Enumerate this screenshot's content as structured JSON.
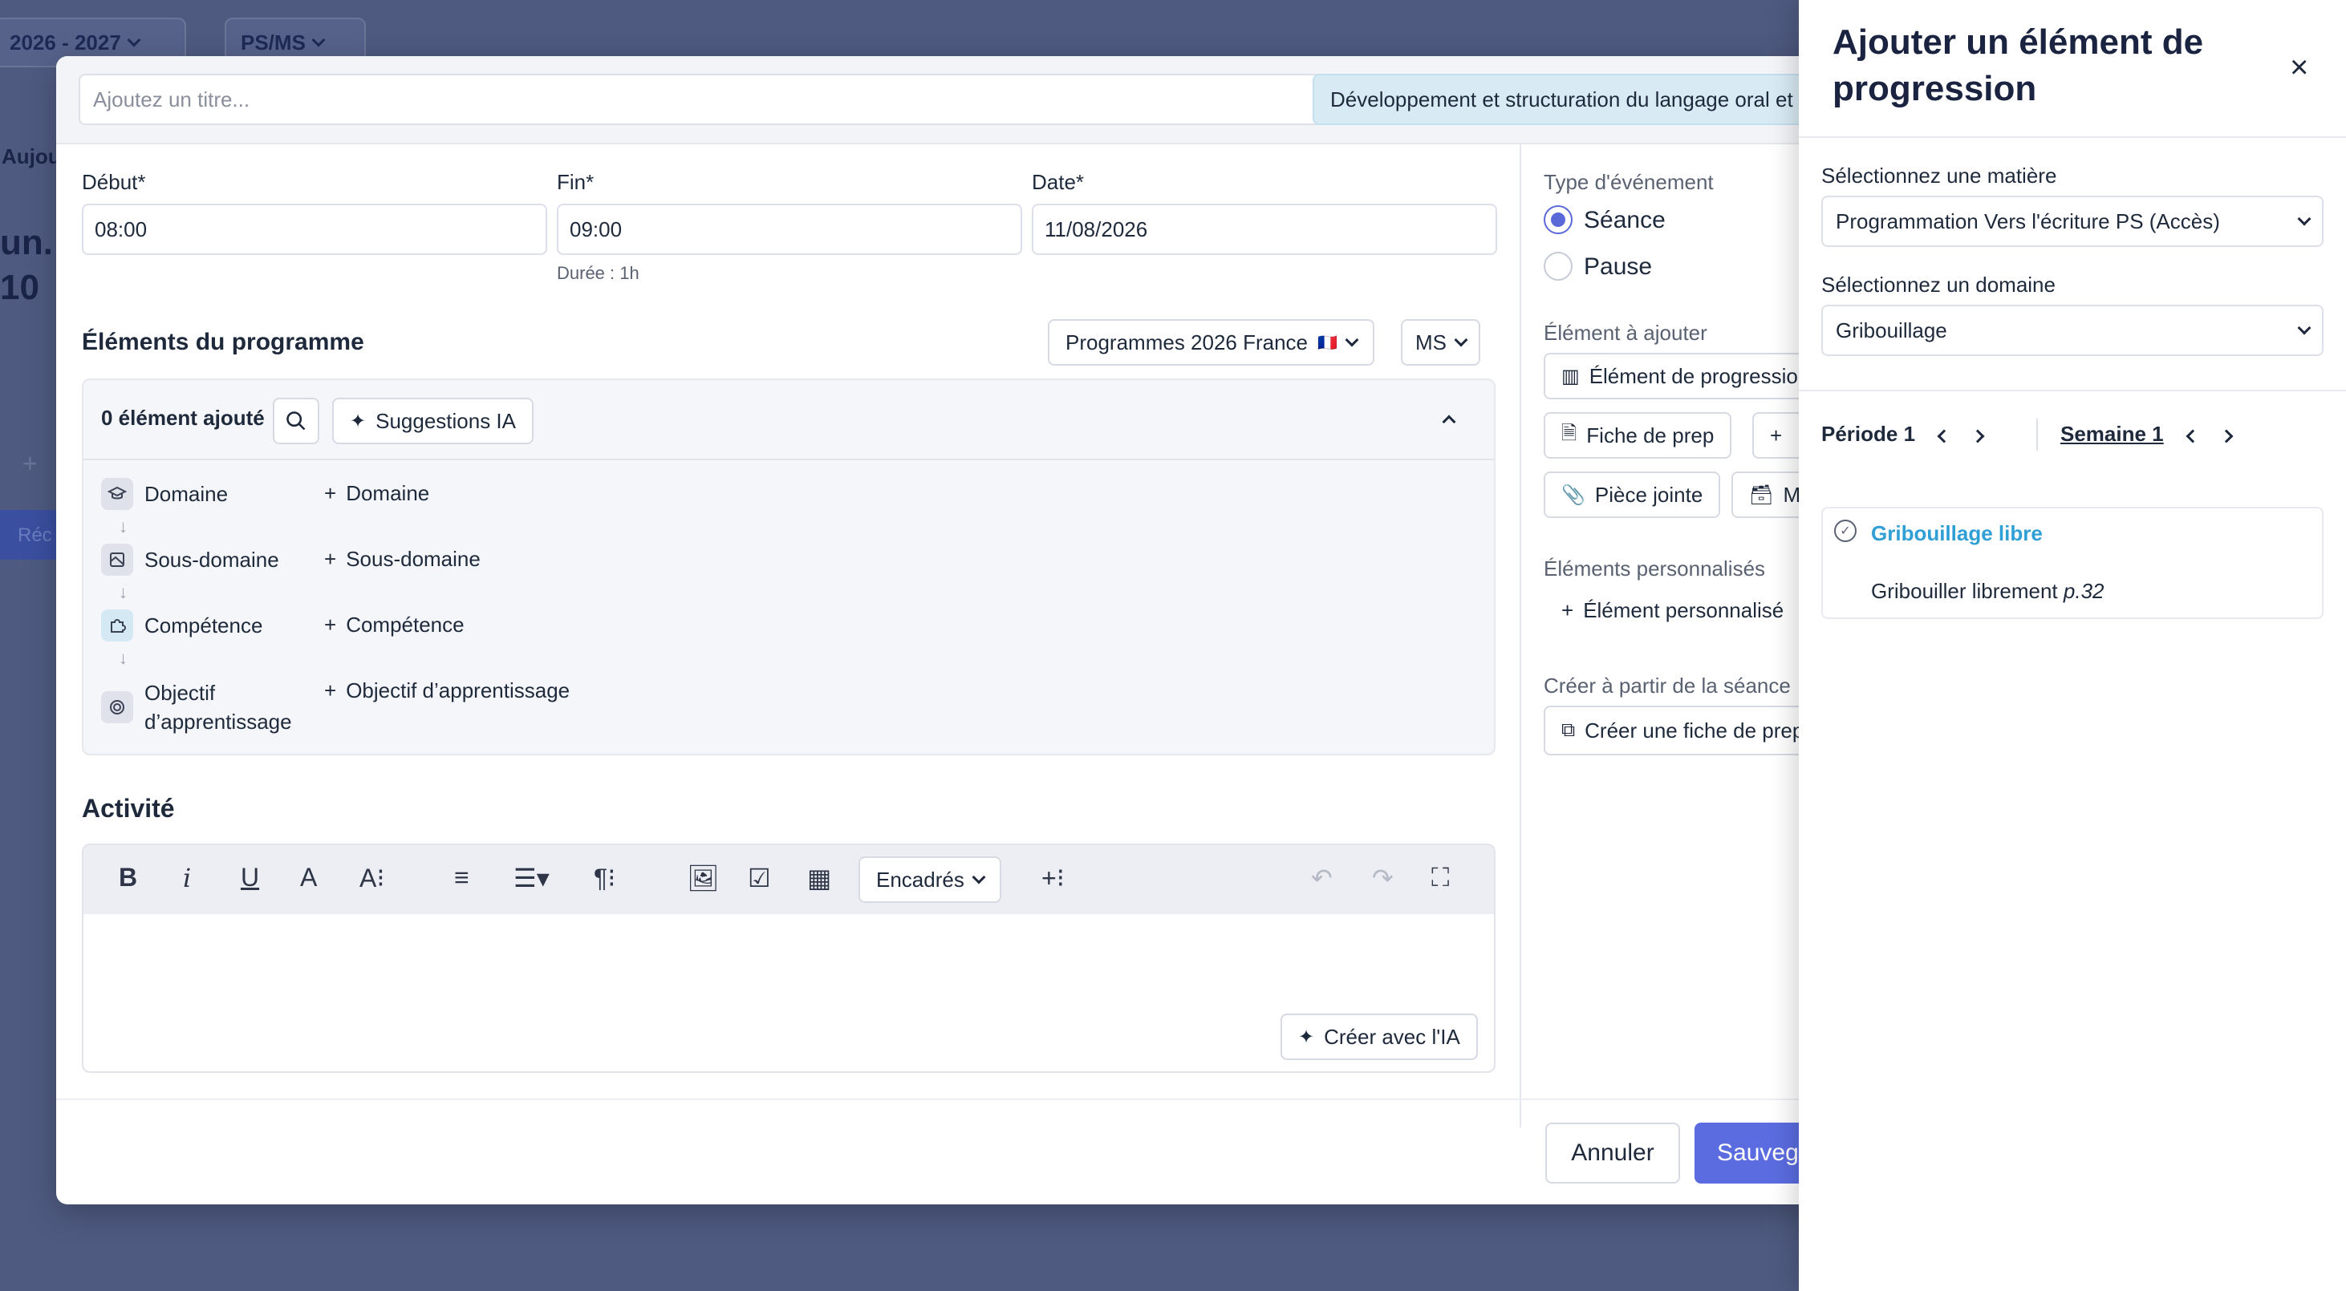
{
  "background": {
    "year_selector": "2026 - 2027",
    "level_selector": "PS/MS",
    "left_text_1": "Aujou",
    "left_text_2": "un.",
    "left_text_3": "10",
    "left_text_4": "Réc",
    "plus": "+"
  },
  "modal": {
    "title_placeholder": "Ajoutez un titre...",
    "subject_chip": "Développement et structuration du langage oral et écrit",
    "start_label": "Début*",
    "start_value": "08:00",
    "end_label": "Fin*",
    "end_value": "09:00",
    "date_label": "Date*",
    "date_value": "11/08/2026",
    "duration": "Durée : 1h",
    "program_title": "Éléments du programme",
    "program_select": "Programmes 2026 France",
    "flag": "🇫🇷",
    "level_select": "MS",
    "added_count": "0 élément ajouté",
    "ai_suggestions": "Suggestions IA",
    "tree": [
      {
        "label": "Domaine",
        "add": "Domaine"
      },
      {
        "label": "Sous-domaine",
        "add": "Sous-domaine"
      },
      {
        "label": "Compétence",
        "add": "Compétence"
      },
      {
        "label_1": "Objectif",
        "label_2": "d’apprentissage",
        "add": "Objectif d’apprentissage"
      }
    ],
    "activity_title": "Activité",
    "toolbar": {
      "encadres": "Encadrés"
    },
    "create_ai": "Créer avec l'IA",
    "event_type_label": "Type d'événement",
    "event_types": [
      "Séance",
      "Pause"
    ],
    "element_to_add_label": "Élément à ajouter",
    "element_buttons": [
      "Élément de progression",
      "Fiche de prep",
      "+",
      "Pièce jointe",
      "M"
    ],
    "custom_elements_label": "Éléments personnalisés",
    "custom_element_add": "Élément personnalisé",
    "create_from_label": "Créer à partir de la séance",
    "create_prep": "Créer une fiche de prep",
    "cancel": "Annuler",
    "save": "Sauvegarder"
  },
  "panel": {
    "title": "Ajouter un élément de progression",
    "subject_label": "Sélectionnez une matière",
    "subject_value": "Programmation Vers l'écriture PS (Accès)",
    "domain_label": "Sélectionnez un domaine",
    "domain_value": "Gribouillage",
    "period": "Période 1",
    "week": "Semaine 1",
    "item_title": "Gribouillage libre",
    "item_desc": "Gribouiller librement",
    "item_page": "p.32"
  },
  "colors": {
    "accent": "#5b6ce0",
    "link": "#2f9fd6",
    "overlay": "#4e5a80"
  }
}
